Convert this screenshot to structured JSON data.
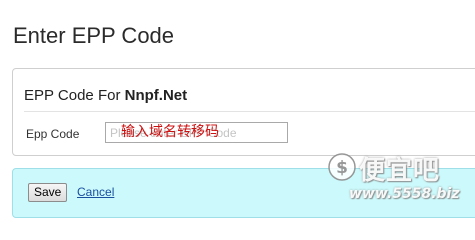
{
  "page": {
    "title": "Enter EPP Code"
  },
  "epp_panel": {
    "heading_prefix": "EPP Code For",
    "domain_name": "Nnpf.Net",
    "field_label": "Epp Code",
    "input_value": "",
    "input_placeholder": "Please enter EPP Code",
    "overlay_hint": "输入域名转移码"
  },
  "actions": {
    "save_label": "Save",
    "cancel_label": "Cancel"
  },
  "watermark": {
    "brand": "便宜吧",
    "url": "www.5558.biz"
  },
  "colors": {
    "actions_background": "#ccfafc",
    "actions_border": "#9edfe8",
    "link": "#1a4fa0",
    "hint_text": "#cc1111"
  },
  "icons": {
    "watermark_logo": "dollar-coin-icon"
  }
}
